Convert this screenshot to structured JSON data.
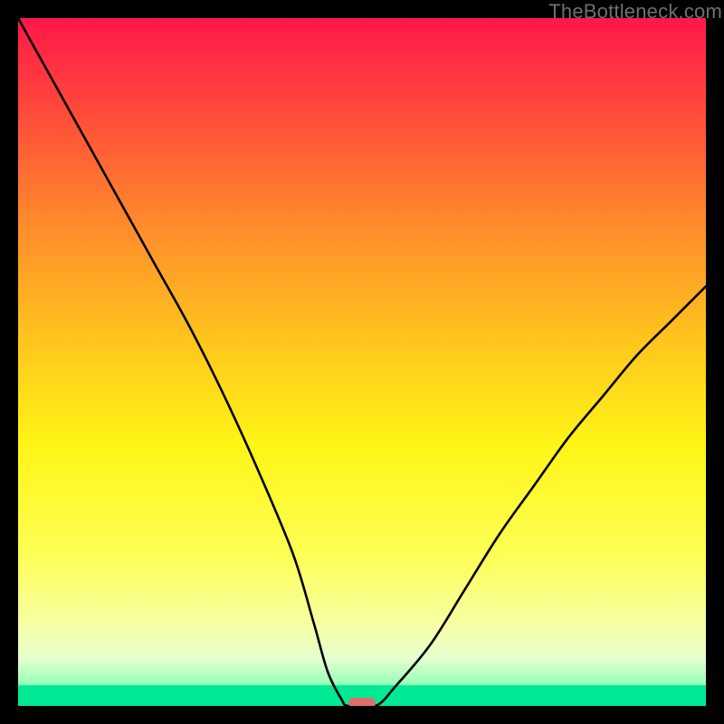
{
  "watermark": "TheBottleneck.com",
  "chart_data": {
    "type": "line",
    "title": "",
    "xlabel": "",
    "ylabel": "",
    "xlim": [
      0,
      100
    ],
    "ylim": [
      0,
      100
    ],
    "background_gradient_top_to_bottom": [
      "#ff1749",
      "#ff4c3a",
      "#ff8b2c",
      "#ffc21e",
      "#fff516",
      "#fdff55",
      "#f7ffa3",
      "#e7ffce",
      "#9effbb",
      "#00e994"
    ],
    "series": [
      {
        "name": "bottleneck-curve",
        "stroke": "#000000",
        "x": [
          0,
          5,
          10,
          15,
          20,
          25,
          30,
          35,
          40,
          43,
          45,
          47,
          48,
          52,
          55,
          60,
          65,
          70,
          75,
          80,
          85,
          90,
          95,
          100
        ],
        "values": [
          100,
          91,
          82,
          73,
          64,
          55,
          45,
          34,
          22,
          12,
          5,
          1,
          0,
          0,
          3,
          9,
          17,
          25,
          32,
          39,
          45,
          51,
          56,
          61
        ]
      }
    ],
    "marker": {
      "name": "optimal-marker",
      "x": 50,
      "y": 0.5,
      "width_pct": 4.0,
      "height_pct": 1.5,
      "fill": "#e06f6a"
    },
    "baseline_green_band": {
      "from_y": 0,
      "to_y": 3,
      "color": "#00e994"
    }
  }
}
